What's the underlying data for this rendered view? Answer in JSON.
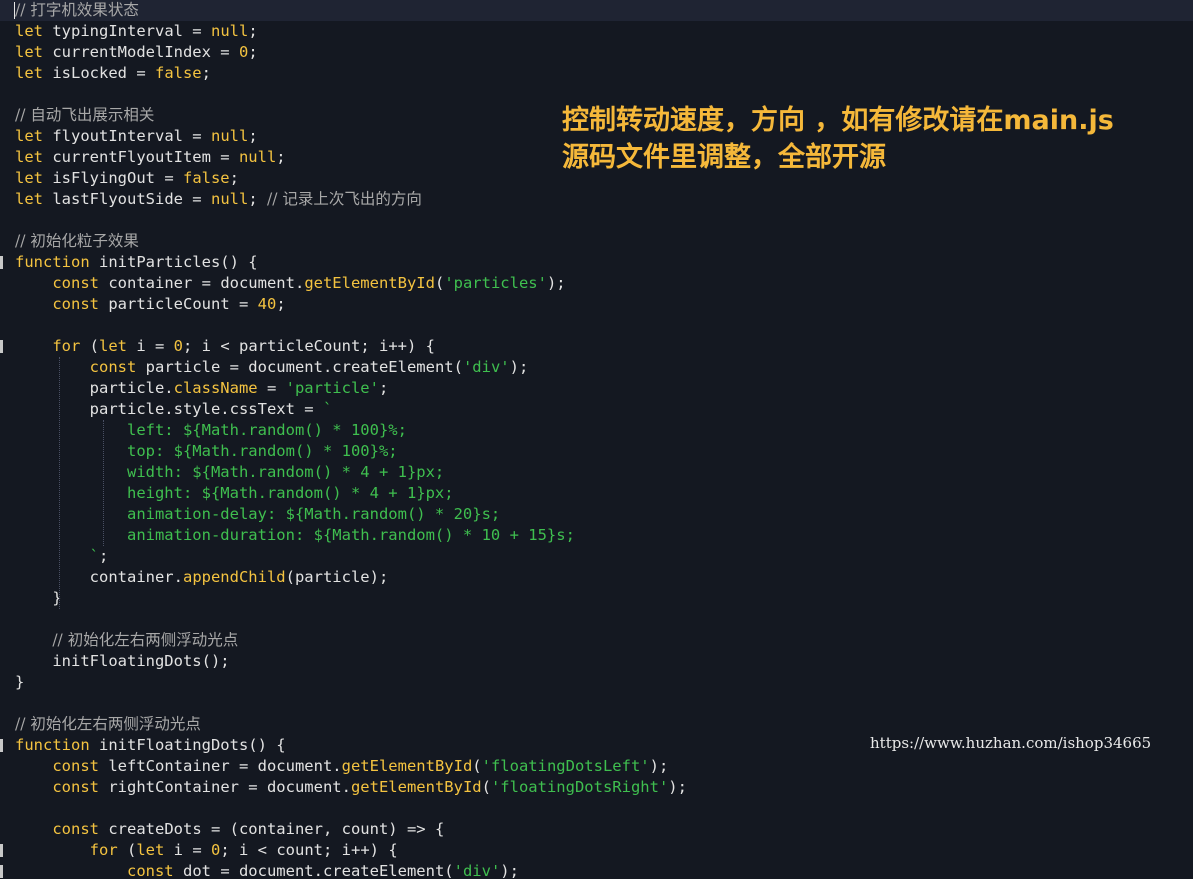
{
  "editor": {
    "lines": [
      {
        "id": "l01",
        "parts": [
          [
            "cm",
            "// 打字机效果状态"
          ]
        ]
      },
      {
        "id": "l02",
        "parts": [
          [
            "kw",
            "let"
          ],
          [
            "t",
            " typingInterval = "
          ],
          [
            "kw",
            "null"
          ],
          [
            "t",
            ";"
          ]
        ]
      },
      {
        "id": "l03",
        "parts": [
          [
            "kw",
            "let"
          ],
          [
            "t",
            " currentModelIndex = "
          ],
          [
            "num",
            "0"
          ],
          [
            "t",
            ";"
          ]
        ]
      },
      {
        "id": "l04",
        "parts": [
          [
            "kw",
            "let"
          ],
          [
            "t",
            " isLocked = "
          ],
          [
            "kw",
            "false"
          ],
          [
            "t",
            ";"
          ]
        ]
      },
      {
        "id": "l05",
        "parts": []
      },
      {
        "id": "l06",
        "parts": [
          [
            "cm",
            "// 自动飞出展示相关"
          ]
        ]
      },
      {
        "id": "l07",
        "parts": [
          [
            "kw",
            "let"
          ],
          [
            "t",
            " flyoutInterval = "
          ],
          [
            "kw",
            "null"
          ],
          [
            "t",
            ";"
          ]
        ]
      },
      {
        "id": "l08",
        "parts": [
          [
            "kw",
            "let"
          ],
          [
            "t",
            " currentFlyoutItem = "
          ],
          [
            "kw",
            "null"
          ],
          [
            "t",
            ";"
          ]
        ]
      },
      {
        "id": "l09",
        "parts": [
          [
            "kw",
            "let"
          ],
          [
            "t",
            " isFlyingOut = "
          ],
          [
            "kw",
            "false"
          ],
          [
            "t",
            ";"
          ]
        ]
      },
      {
        "id": "l10",
        "parts": [
          [
            "kw",
            "let"
          ],
          [
            "t",
            " lastFlyoutSide = "
          ],
          [
            "kw",
            "null"
          ],
          [
            "t",
            "; "
          ],
          [
            "cm",
            "// 记录上次飞出的方向"
          ]
        ]
      },
      {
        "id": "l11",
        "parts": []
      },
      {
        "id": "l12",
        "parts": [
          [
            "cm",
            "// 初始化粒子效果"
          ]
        ]
      },
      {
        "id": "l13",
        "parts": [
          [
            "kw",
            "function"
          ],
          [
            "t",
            " initParticles() {"
          ]
        ]
      },
      {
        "id": "l14",
        "parts": [
          [
            "t",
            "    "
          ],
          [
            "kw",
            "const"
          ],
          [
            "t",
            " container = document."
          ],
          [
            "fn",
            "getElementById"
          ],
          [
            "t",
            "("
          ],
          [
            "str",
            "'particles'"
          ],
          [
            "t",
            ");"
          ]
        ]
      },
      {
        "id": "l15",
        "parts": [
          [
            "t",
            "    "
          ],
          [
            "kw",
            "const"
          ],
          [
            "t",
            " particleCount = "
          ],
          [
            "num",
            "40"
          ],
          [
            "t",
            ";"
          ]
        ]
      },
      {
        "id": "l16",
        "parts": []
      },
      {
        "id": "l17",
        "parts": [
          [
            "t",
            "    "
          ],
          [
            "kw",
            "for"
          ],
          [
            "t",
            " ("
          ],
          [
            "kw",
            "let"
          ],
          [
            "t",
            " i = "
          ],
          [
            "num",
            "0"
          ],
          [
            "t",
            "; i < particleCount; i++) {"
          ]
        ]
      },
      {
        "id": "l18",
        "parts": [
          [
            "t",
            "        "
          ],
          [
            "kw",
            "const"
          ],
          [
            "t",
            " particle = document.createElement("
          ],
          [
            "str",
            "'div'"
          ],
          [
            "t",
            ");"
          ]
        ]
      },
      {
        "id": "l19",
        "parts": [
          [
            "t",
            "        particle."
          ],
          [
            "fn",
            "className"
          ],
          [
            "t",
            " = "
          ],
          [
            "str",
            "'particle'"
          ],
          [
            "t",
            ";"
          ]
        ]
      },
      {
        "id": "l20",
        "parts": [
          [
            "t",
            "        particle.style.cssText = "
          ],
          [
            "str",
            "`"
          ]
        ]
      },
      {
        "id": "l21",
        "parts": [
          [
            "t",
            "            "
          ],
          [
            "tpl",
            "left: ${Math.random() * 100}%;"
          ]
        ]
      },
      {
        "id": "l22",
        "parts": [
          [
            "t",
            "            "
          ],
          [
            "tpl",
            "top: ${Math.random() * 100}%;"
          ]
        ]
      },
      {
        "id": "l23",
        "parts": [
          [
            "t",
            "            "
          ],
          [
            "tpl",
            "width: ${Math.random() * 4 + 1}px;"
          ]
        ]
      },
      {
        "id": "l24",
        "parts": [
          [
            "t",
            "            "
          ],
          [
            "tpl",
            "height: ${Math.random() * 4 + 1}px;"
          ]
        ]
      },
      {
        "id": "l25",
        "parts": [
          [
            "t",
            "            "
          ],
          [
            "tpl",
            "animation-delay: ${Math.random() * 20}s;"
          ]
        ]
      },
      {
        "id": "l26",
        "parts": [
          [
            "t",
            "            "
          ],
          [
            "tpl",
            "animation-duration: ${Math.random() * 10 + 15}s;"
          ]
        ]
      },
      {
        "id": "l27",
        "parts": [
          [
            "t",
            "        "
          ],
          [
            "str",
            "`"
          ],
          [
            "t",
            ";"
          ]
        ]
      },
      {
        "id": "l28",
        "parts": [
          [
            "t",
            "        container."
          ],
          [
            "fn",
            "appendChild"
          ],
          [
            "t",
            "(particle);"
          ]
        ]
      },
      {
        "id": "l29",
        "parts": [
          [
            "t",
            "    }"
          ]
        ]
      },
      {
        "id": "l30",
        "parts": []
      },
      {
        "id": "l31",
        "parts": [
          [
            "t",
            "    "
          ],
          [
            "cm",
            "// 初始化左右两侧浮动光点"
          ]
        ]
      },
      {
        "id": "l32",
        "parts": [
          [
            "t",
            "    initFloatingDots();"
          ]
        ]
      },
      {
        "id": "l33",
        "parts": [
          [
            "t",
            "}"
          ]
        ]
      },
      {
        "id": "l34",
        "parts": []
      },
      {
        "id": "l35",
        "parts": [
          [
            "cm",
            "// 初始化左右两侧浮动光点"
          ]
        ]
      },
      {
        "id": "l36",
        "parts": [
          [
            "kw",
            "function"
          ],
          [
            "t",
            " initFloatingDots() {"
          ]
        ]
      },
      {
        "id": "l37",
        "parts": [
          [
            "t",
            "    "
          ],
          [
            "kw",
            "const"
          ],
          [
            "t",
            " leftContainer = document."
          ],
          [
            "fn",
            "getElementById"
          ],
          [
            "t",
            "("
          ],
          [
            "str",
            "'floatingDotsLeft'"
          ],
          [
            "t",
            ");"
          ]
        ]
      },
      {
        "id": "l38",
        "parts": [
          [
            "t",
            "    "
          ],
          [
            "kw",
            "const"
          ],
          [
            "t",
            " rightContainer = document."
          ],
          [
            "fn",
            "getElementById"
          ],
          [
            "t",
            "("
          ],
          [
            "str",
            "'floatingDotsRight'"
          ],
          [
            "t",
            ");"
          ]
        ]
      },
      {
        "id": "l39",
        "parts": []
      },
      {
        "id": "l40",
        "parts": [
          [
            "t",
            "    "
          ],
          [
            "kw",
            "const"
          ],
          [
            "t",
            " createDots = (container, count) => {"
          ]
        ]
      },
      {
        "id": "l41",
        "parts": [
          [
            "t",
            "        "
          ],
          [
            "kw",
            "for"
          ],
          [
            "t",
            " ("
          ],
          [
            "kw",
            "let"
          ],
          [
            "t",
            " i = "
          ],
          [
            "num",
            "0"
          ],
          [
            "t",
            "; i < count; i++) {"
          ]
        ]
      },
      {
        "id": "l42",
        "parts": [
          [
            "t",
            "            "
          ],
          [
            "kw",
            "const"
          ],
          [
            "t",
            " dot = document.createElement("
          ],
          [
            "str",
            "'div'"
          ],
          [
            "t",
            ");"
          ]
        ]
      }
    ]
  },
  "annotation": {
    "line1": "控制转动速度，方向 ，如有修改请在main.js",
    "line2": "源码文件里调整，全部开源"
  },
  "watermark": "https://www.huzhan.com/ishop34665",
  "colors": {
    "background": "#141821",
    "keyword": "#f4c340",
    "string": "#3fbf4f",
    "comment": "#a8a8a8",
    "annotation": "#f5b83a"
  }
}
